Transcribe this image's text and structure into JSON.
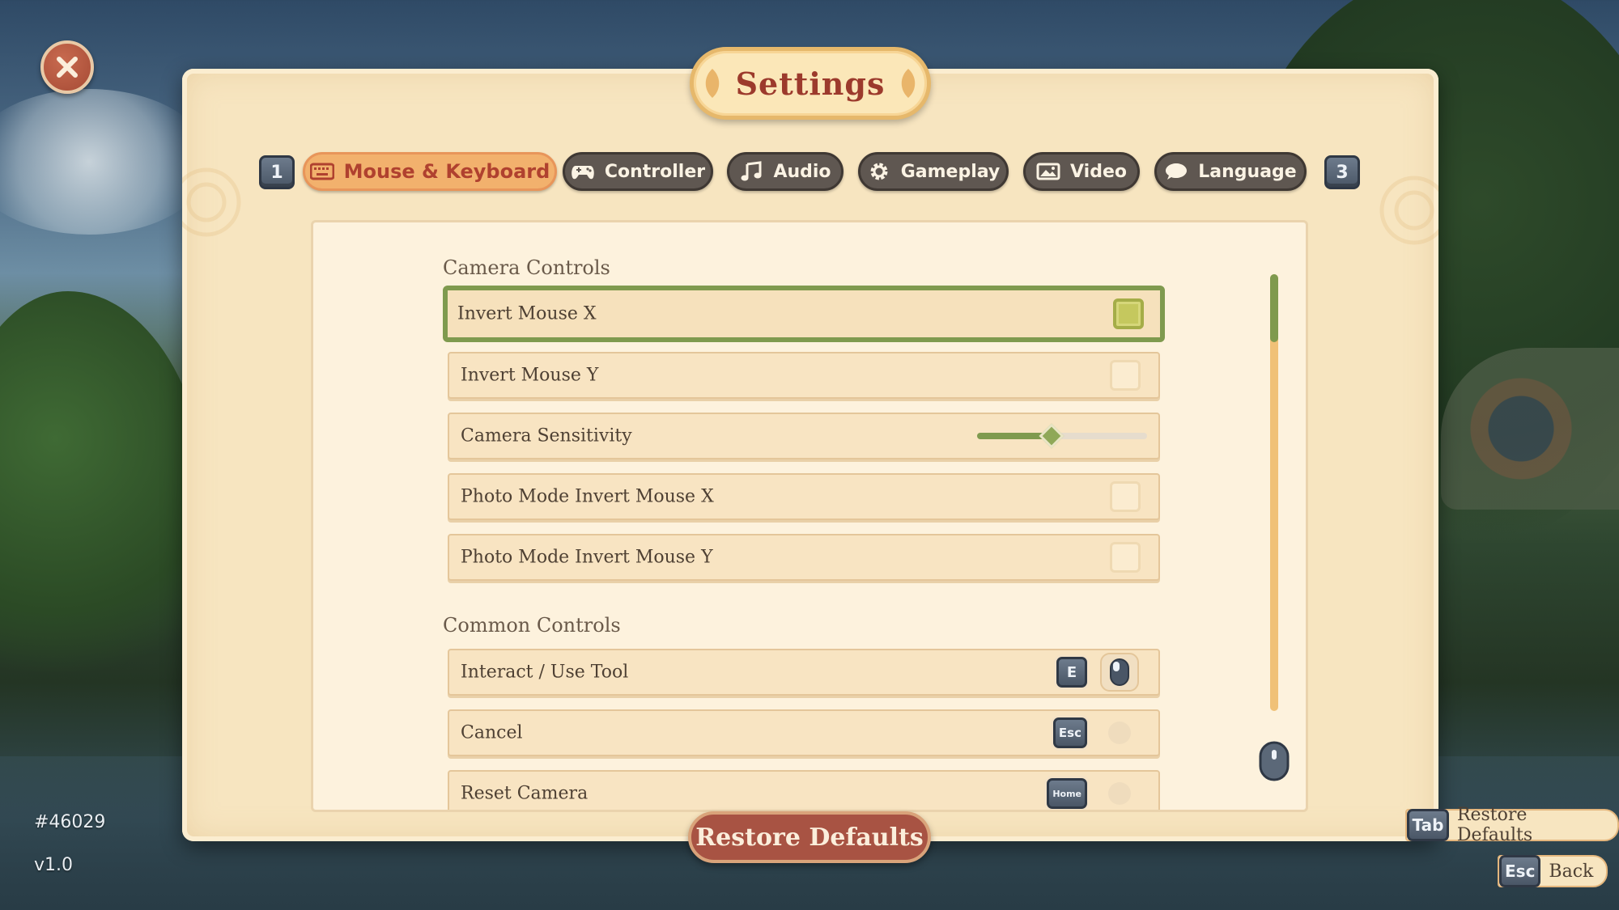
{
  "header": {
    "title": "Settings"
  },
  "tabs": {
    "prev_key": "1",
    "next_key": "3",
    "items": [
      {
        "label": "Mouse & Keyboard",
        "icon": "keyboard-icon",
        "active": true
      },
      {
        "label": "Controller",
        "icon": "gamepad-icon",
        "active": false
      },
      {
        "label": "Audio",
        "icon": "music-note-icon",
        "active": false
      },
      {
        "label": "Gameplay",
        "icon": "gear-icon",
        "active": false
      },
      {
        "label": "Video",
        "icon": "image-icon",
        "active": false
      },
      {
        "label": "Language",
        "icon": "speech-bubble-icon",
        "active": false
      }
    ]
  },
  "camera_controls": {
    "title": "Camera Controls",
    "rows": [
      {
        "label": "Invert Mouse X",
        "type": "checkbox",
        "checked": true
      },
      {
        "label": "Invert Mouse Y",
        "type": "checkbox",
        "checked": false
      },
      {
        "label": "Camera Sensitivity",
        "type": "slider",
        "value": 0.44
      },
      {
        "label": "Photo Mode Invert Mouse X",
        "type": "checkbox",
        "checked": false
      },
      {
        "label": "Photo Mode Invert Mouse Y",
        "type": "checkbox",
        "checked": false
      }
    ]
  },
  "common_controls": {
    "title": "Common Controls",
    "rows": [
      {
        "label": "Interact / Use Tool",
        "key": "E",
        "mouse": "left-click"
      },
      {
        "label": "Cancel",
        "key": "Esc"
      },
      {
        "label": "Reset Camera",
        "key": "Home"
      }
    ]
  },
  "footer": {
    "restore_defaults": "Restore Defaults",
    "build_id": "#46029",
    "version": "v1.0"
  },
  "hints": {
    "restore": {
      "key": "Tab",
      "label": "Restore Defaults"
    },
    "back": {
      "key": "Esc",
      "label": "Back"
    }
  },
  "colors": {
    "accent_green": "#7f9a4e",
    "title_red": "#9c3a2c",
    "panel_bg": "#f7e5c0",
    "tab_active": "#f2b16d",
    "tab_inactive": "#5f5751"
  }
}
